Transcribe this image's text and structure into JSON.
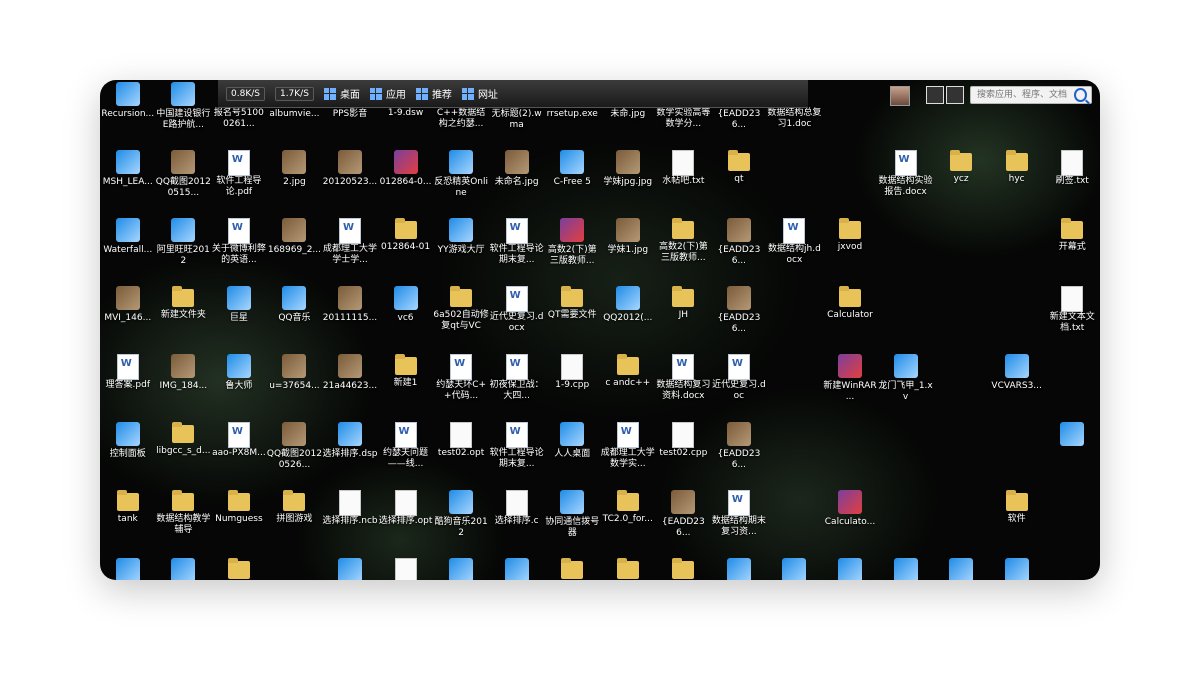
{
  "taskbar": {
    "speed_down": "0.8K/S",
    "speed_up": "1.7K/S",
    "menu_desktop": "桌面",
    "menu_apps": "应用",
    "menu_recommend": "推荐",
    "menu_web": "网址",
    "search_placeholder": "搜索应用、程序、文档"
  },
  "desktop": {
    "icons": [
      {
        "label": "Recursion...",
        "type": "app"
      },
      {
        "label": "中国建设银行E路护航...",
        "type": "app"
      },
      {
        "label": "报名号51000261...",
        "type": "doc"
      },
      {
        "label": "albumvie...",
        "type": "app"
      },
      {
        "label": "PPS影音",
        "type": "app"
      },
      {
        "label": "1-9.dsw",
        "type": "txt"
      },
      {
        "label": "C++数据结构之约瑟...",
        "type": "doc"
      },
      {
        "label": "无标题(2).wma",
        "type": "app"
      },
      {
        "label": "rrsetup.exe",
        "type": "app"
      },
      {
        "label": "未命.jpg",
        "type": "img"
      },
      {
        "label": "数学实验高等数学分...",
        "type": "doc"
      },
      {
        "label": "{EADD236...",
        "type": "img"
      },
      {
        "label": "数据结构总复习1.doc",
        "type": "doc"
      },
      {
        "label": "",
        "type": "blank"
      },
      {
        "label": "",
        "type": "blank"
      },
      {
        "label": "",
        "type": "blank"
      },
      {
        "label": "",
        "type": "blank"
      },
      {
        "label": "",
        "type": "blank"
      },
      {
        "label": "MSH_LEA...",
        "type": "app"
      },
      {
        "label": "QQ截图20120515...",
        "type": "img"
      },
      {
        "label": "软件工程导论.pdf",
        "type": "doc"
      },
      {
        "label": "2.jpg",
        "type": "img"
      },
      {
        "label": "20120523...",
        "type": "img"
      },
      {
        "label": "012864-0...",
        "type": "rar"
      },
      {
        "label": "反恐精英Online",
        "type": "app"
      },
      {
        "label": "未命名.jpg",
        "type": "img"
      },
      {
        "label": "C-Free 5",
        "type": "app"
      },
      {
        "label": "学妹jpg.jpg",
        "type": "img"
      },
      {
        "label": "水帖吧.txt",
        "type": "txt"
      },
      {
        "label": "qt",
        "type": "folder"
      },
      {
        "label": "",
        "type": "blank"
      },
      {
        "label": "",
        "type": "blank"
      },
      {
        "label": "数据结构实验报告.docx",
        "type": "doc"
      },
      {
        "label": "ycz",
        "type": "folder"
      },
      {
        "label": "hyc",
        "type": "folder"
      },
      {
        "label": "刷签.txt",
        "type": "txt"
      },
      {
        "label": "Waterfall...",
        "type": "app"
      },
      {
        "label": "阿里旺旺2012",
        "type": "app"
      },
      {
        "label": "关于微博利弊的英语...",
        "type": "doc"
      },
      {
        "label": "168969_2...",
        "type": "img"
      },
      {
        "label": "成都理工大学学士学...",
        "type": "doc"
      },
      {
        "label": "012864-01",
        "type": "folder"
      },
      {
        "label": "YY游戏大厅",
        "type": "app"
      },
      {
        "label": "软件工程导论期末复...",
        "type": "doc"
      },
      {
        "label": "高数2(下)第三版教师...",
        "type": "rar"
      },
      {
        "label": "学妹1.jpg",
        "type": "img"
      },
      {
        "label": "高数2(下)第三版教师...",
        "type": "folder"
      },
      {
        "label": "{EADD236...",
        "type": "img"
      },
      {
        "label": "数据结构jh.docx",
        "type": "doc"
      },
      {
        "label": "jxvod",
        "type": "folder"
      },
      {
        "label": "",
        "type": "blank"
      },
      {
        "label": "",
        "type": "blank"
      },
      {
        "label": "",
        "type": "blank"
      },
      {
        "label": "开幕式",
        "type": "folder"
      },
      {
        "label": "MVI_146...",
        "type": "img"
      },
      {
        "label": "新建文件夹",
        "type": "folder"
      },
      {
        "label": "巨星",
        "type": "app"
      },
      {
        "label": "QQ音乐",
        "type": "app"
      },
      {
        "label": "20111115...",
        "type": "img"
      },
      {
        "label": "vc6",
        "type": "app"
      },
      {
        "label": "6a502自动修复qt与VC",
        "type": "folder"
      },
      {
        "label": "近代史复习.docx",
        "type": "doc"
      },
      {
        "label": "QT需要文件",
        "type": "folder"
      },
      {
        "label": "QQ2012(...",
        "type": "app"
      },
      {
        "label": "JH",
        "type": "folder"
      },
      {
        "label": "{EADD236...",
        "type": "img"
      },
      {
        "label": "",
        "type": "blank"
      },
      {
        "label": "Calculator",
        "type": "folder"
      },
      {
        "label": "",
        "type": "blank"
      },
      {
        "label": "",
        "type": "blank"
      },
      {
        "label": "",
        "type": "blank"
      },
      {
        "label": "新建文本文档.txt",
        "type": "txt"
      },
      {
        "label": "理答案.pdf",
        "type": "doc"
      },
      {
        "label": "IMG_184...",
        "type": "img"
      },
      {
        "label": "鲁大师",
        "type": "app"
      },
      {
        "label": "u=37654...",
        "type": "img"
      },
      {
        "label": "21a44623...",
        "type": "img"
      },
      {
        "label": "新建1",
        "type": "folder"
      },
      {
        "label": "约瑟夫环C++代码...",
        "type": "doc"
      },
      {
        "label": "初夜保卫战：大四...",
        "type": "doc"
      },
      {
        "label": "1-9.cpp",
        "type": "txt"
      },
      {
        "label": "c andc++",
        "type": "folder"
      },
      {
        "label": "数据结构复习资料.docx",
        "type": "doc"
      },
      {
        "label": "近代史复习.doc",
        "type": "doc"
      },
      {
        "label": "",
        "type": "blank"
      },
      {
        "label": "新建WinRAR ...",
        "type": "rar"
      },
      {
        "label": "龙门飞甲_1.xv",
        "type": "app"
      },
      {
        "label": "",
        "type": "blank"
      },
      {
        "label": "VCVARS3...",
        "type": "app"
      },
      {
        "label": "",
        "type": "blank"
      },
      {
        "label": "控制面板",
        "type": "app"
      },
      {
        "label": "libgcc_s_d...",
        "type": "folder"
      },
      {
        "label": "aao-PX8M...",
        "type": "doc"
      },
      {
        "label": "QQ截图20120526...",
        "type": "img"
      },
      {
        "label": "选择排序.dsp",
        "type": "app"
      },
      {
        "label": "约瑟夫问题——线...",
        "type": "doc"
      },
      {
        "label": "test02.opt",
        "type": "txt"
      },
      {
        "label": "软件工程导论期末复...",
        "type": "doc"
      },
      {
        "label": "人人桌面",
        "type": "app"
      },
      {
        "label": "成都理工大学数学实...",
        "type": "doc"
      },
      {
        "label": "test02.cpp",
        "type": "txt"
      },
      {
        "label": "{EADD236...",
        "type": "img"
      },
      {
        "label": "",
        "type": "blank"
      },
      {
        "label": "",
        "type": "blank"
      },
      {
        "label": "",
        "type": "blank"
      },
      {
        "label": "",
        "type": "blank"
      },
      {
        "label": "",
        "type": "blank"
      },
      {
        "label": "",
        "type": "app"
      },
      {
        "label": "tank",
        "type": "folder"
      },
      {
        "label": "数据结构教学辅导",
        "type": "folder"
      },
      {
        "label": "Numguess",
        "type": "folder"
      },
      {
        "label": "拼图游戏",
        "type": "folder"
      },
      {
        "label": "选择排序.ncb",
        "type": "txt"
      },
      {
        "label": "选择排序.opt",
        "type": "txt"
      },
      {
        "label": "酷狗音乐2012",
        "type": "app"
      },
      {
        "label": "选择排序.c",
        "type": "txt"
      },
      {
        "label": "协同通信拨号器",
        "type": "app"
      },
      {
        "label": "TC2.0_for...",
        "type": "folder"
      },
      {
        "label": "{EADD236...",
        "type": "img"
      },
      {
        "label": "数据结构期末复习资...",
        "type": "doc"
      },
      {
        "label": "",
        "type": "blank"
      },
      {
        "label": "Calculato...",
        "type": "rar"
      },
      {
        "label": "",
        "type": "blank"
      },
      {
        "label": "",
        "type": "blank"
      },
      {
        "label": "软件",
        "type": "folder"
      },
      {
        "label": "",
        "type": "blank"
      },
      {
        "label": "",
        "type": "app"
      },
      {
        "label": "",
        "type": "app"
      },
      {
        "label": "",
        "type": "folder"
      },
      {
        "label": "",
        "type": "blank"
      },
      {
        "label": "",
        "type": "app"
      },
      {
        "label": "",
        "type": "txt"
      },
      {
        "label": "",
        "type": "app"
      },
      {
        "label": "",
        "type": "app"
      },
      {
        "label": "",
        "type": "folder"
      },
      {
        "label": "",
        "type": "folder"
      },
      {
        "label": "",
        "type": "folder"
      },
      {
        "label": "",
        "type": "app"
      },
      {
        "label": "",
        "type": "app"
      },
      {
        "label": "",
        "type": "app"
      },
      {
        "label": "",
        "type": "app"
      },
      {
        "label": "",
        "type": "app"
      },
      {
        "label": "",
        "type": "app"
      },
      {
        "label": "",
        "type": "blank"
      }
    ]
  },
  "colors": {
    "folder": "#e8c35a",
    "accent_blue": "#1d62c9"
  }
}
